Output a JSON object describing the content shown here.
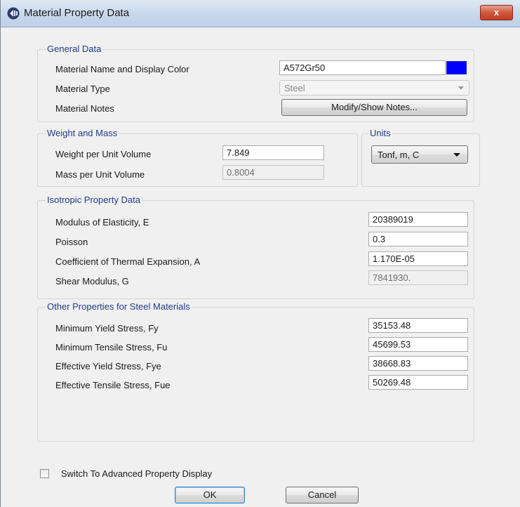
{
  "window": {
    "title": "Material Property Data",
    "close_label": "x"
  },
  "general": {
    "title": "General Data",
    "name_label": "Material Name and Display Color",
    "name_value": "A572Gr50",
    "display_color": "#0000ff",
    "type_label": "Material Type",
    "type_value": "Steel",
    "notes_label": "Material Notes",
    "notes_button": "Modify/Show Notes..."
  },
  "weight": {
    "title": "Weight and Mass",
    "weight_label": "Weight per Unit Volume",
    "weight_value": "7.849",
    "mass_label": "Mass per Unit Volume",
    "mass_value": "0.8004"
  },
  "units": {
    "title": "Units",
    "value": "Tonf, m, C"
  },
  "isotropic": {
    "title": "Isotropic Property Data",
    "rows": [
      {
        "label": "Modulus of Elasticity,  E",
        "value": "20389019"
      },
      {
        "label": "Poisson",
        "value": "0.3"
      },
      {
        "label": "Coefficient of Thermal Expansion,  A",
        "value": "1.170E-05"
      },
      {
        "label": "Shear Modulus,  G",
        "value": "7841930."
      }
    ]
  },
  "steel": {
    "title": "Other Properties for Steel Materials",
    "rows": [
      {
        "label": "Minimum Yield Stress, Fy",
        "value": "35153.48"
      },
      {
        "label": "Minimum Tensile Stress, Fu",
        "value": "45699.53"
      },
      {
        "label": "Effective Yield Stress, Fye",
        "value": "38668.83"
      },
      {
        "label": "Effective Tensile Stress, Fue",
        "value": "50269.48"
      }
    ]
  },
  "advanced_label": "Switch To Advanced Property Display",
  "ok_label": "OK",
  "cancel_label": "Cancel"
}
